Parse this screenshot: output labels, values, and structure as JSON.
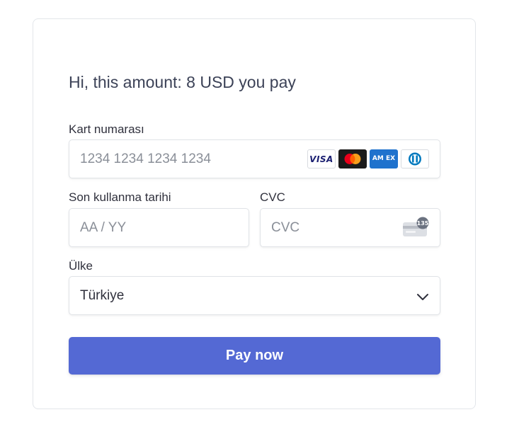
{
  "payment": {
    "title": "Hi, this amount: 8 USD you pay",
    "card_number": {
      "label": "Kart numarası",
      "placeholder": "1234 1234 1234 1234",
      "value": "",
      "brands": [
        "visa-icon",
        "mastercard-icon",
        "amex-icon",
        "diners-icon"
      ],
      "visa_text": "VISA",
      "amex_text": "AM EX"
    },
    "expiry": {
      "label": "Son kullanma tarihi",
      "placeholder": "AA / YY",
      "value": ""
    },
    "cvc": {
      "label": "CVC",
      "placeholder": "CVC",
      "value": "",
      "icon": "cvc-card-icon",
      "icon_digits": "135"
    },
    "country": {
      "label": "Ülke",
      "selected": "Türkiye",
      "icon": "chevron-down-icon"
    },
    "pay_button": "Pay now"
  },
  "colors": {
    "accent": "#5469d4",
    "text": "#30313d",
    "placeholder": "#8a8f98",
    "border": "#e0e3e7"
  }
}
